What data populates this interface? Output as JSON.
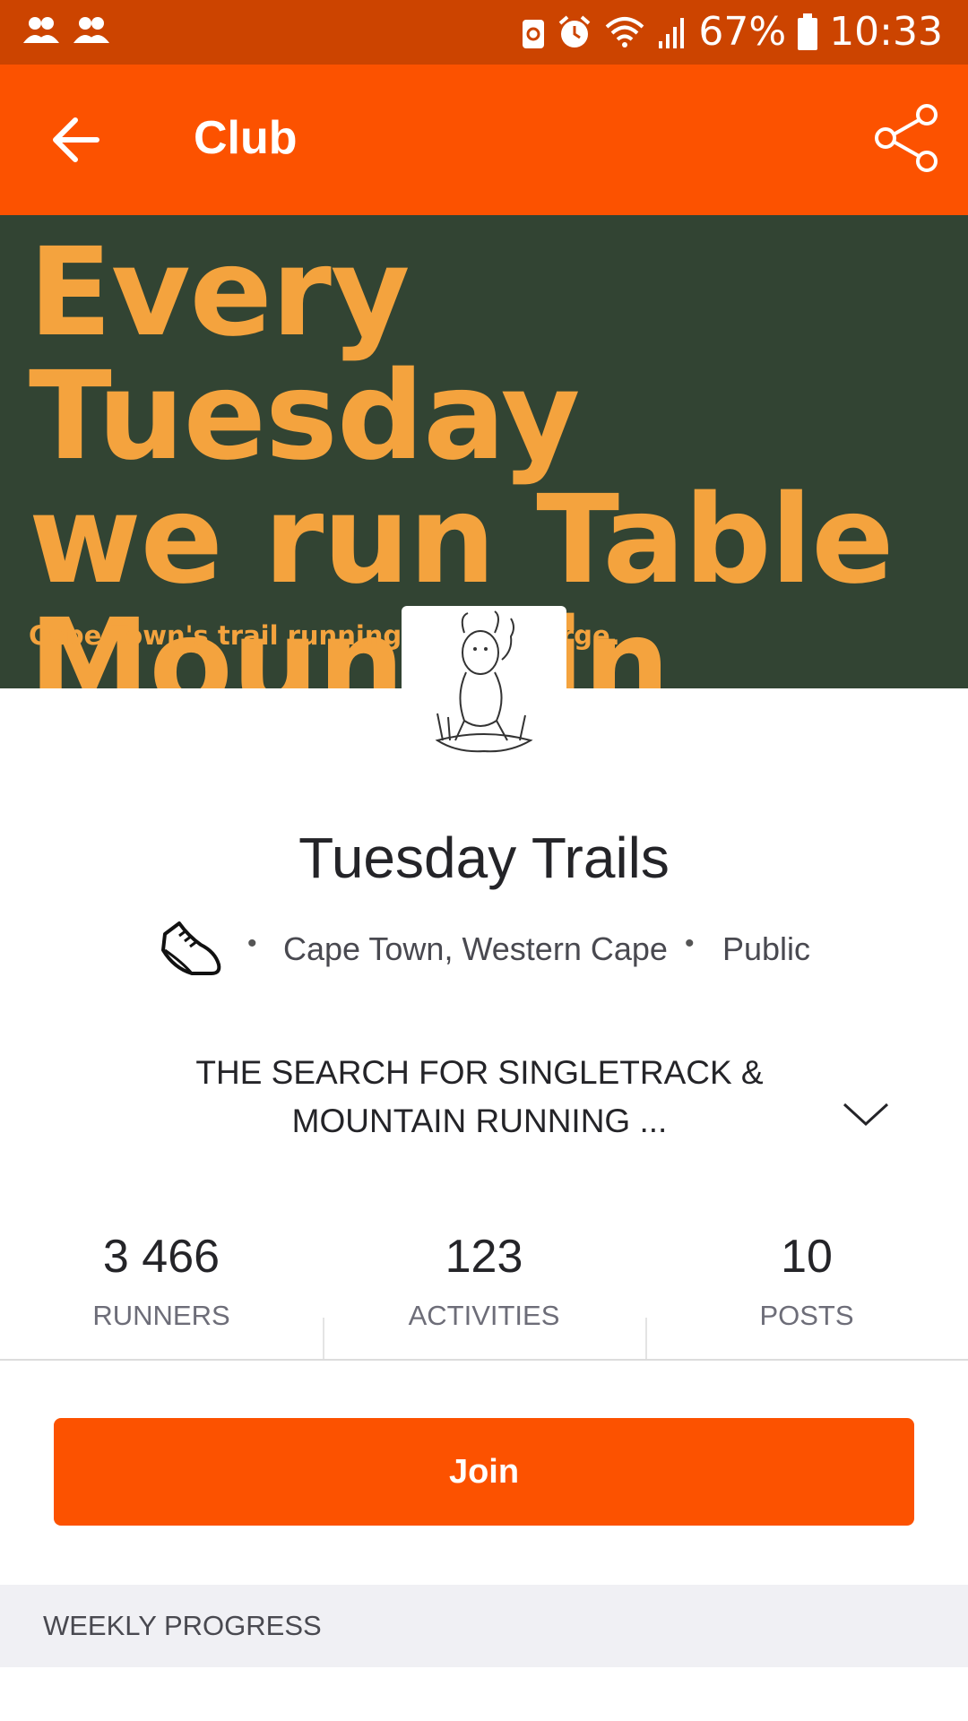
{
  "status_bar": {
    "left_icons": [
      "group-icon",
      "group-icon"
    ],
    "right_icons": [
      "recycle-icon",
      "alarm-icon",
      "wifi-icon",
      "signal-icon",
      "battery-icon"
    ],
    "battery": "67%",
    "time": "10:33"
  },
  "app_bar": {
    "title": "Club",
    "back_icon": "arrow-left-icon",
    "share_icon": "share-icon"
  },
  "banner": {
    "headline_lines": [
      "Every Tuesday",
      "we run Table",
      "Mountain trails."
    ],
    "subline": "Cape Town's trail running co          large."
  },
  "club": {
    "name": "Tuesday Trails",
    "sport_icon": "running-shoe-icon",
    "location": "Cape Town, Western Cape",
    "privacy": "Public",
    "description": "THE SEARCH FOR SINGLETRACK & MOUNTAIN RUNNING ...",
    "expand_icon": "chevron-down-icon"
  },
  "stats": [
    {
      "value": "3 466",
      "label": "RUNNERS"
    },
    {
      "value": "123",
      "label": "ACTIVITIES"
    },
    {
      "value": "10",
      "label": "POSTS"
    }
  ],
  "join_label": "Join",
  "weekly_progress_label": "WEEKLY PROGRESS",
  "colors": {
    "brand": "#fc5200",
    "status_bar": "#cc4400",
    "banner_bg": "#324433",
    "banner_text": "#f4a33e"
  }
}
